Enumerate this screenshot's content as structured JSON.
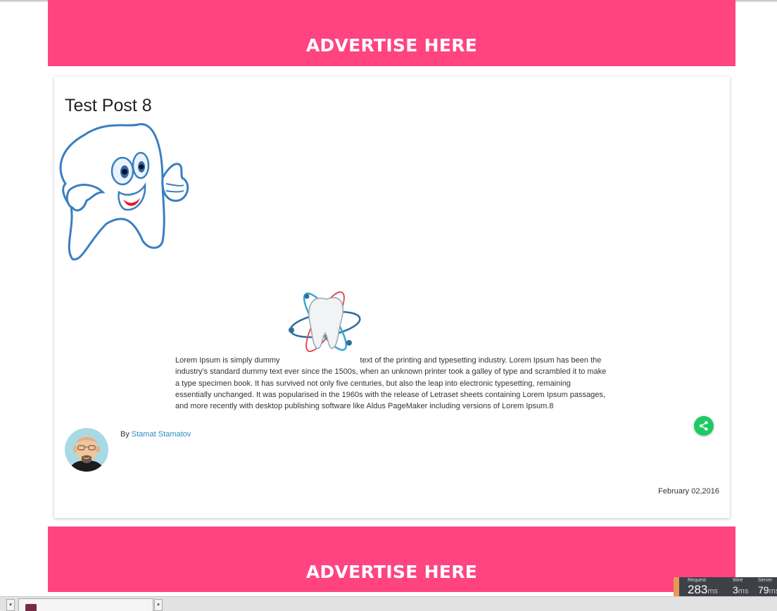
{
  "ads": {
    "top_label": "ADVERTISE HERE",
    "bottom_label": "ADVERTISE HERE"
  },
  "post": {
    "title": "Test Post 8",
    "body_before_image": "Lorem Ipsum is simply dummy",
    "body_after_image": "text of the printing and typesetting industry. Lorem Ipsum has been the industry's standard dummy text ever since the 1500s, when an unknown printer took a galley of type and scrambled it to make a type specimen book. It has survived not only five centuries, but also the leap into electronic typesetting, remaining essentially unchanged. It was popularised in the 1960s with the release of Letraset sheets containing Lorem Ipsum passages, and more recently with desktop publishing software like Aldus PageMaker including versions of Lorem Ipsum.8",
    "by_label": "By",
    "author": "Stamat Stamatov",
    "date": "February 02,2016",
    "share_icon": "share-icon",
    "share_color": "#1ec964"
  },
  "colors": {
    "ad_background": "#ff4481",
    "link": "#2a8bc6"
  },
  "perf": {
    "request_label": "Request",
    "request_value": "283",
    "wire_label": "Wire",
    "wire_value": "3",
    "server_label": "Server",
    "server_value": "79",
    "unit": "ms"
  },
  "taskbar": {
    "tab_text": "..."
  }
}
